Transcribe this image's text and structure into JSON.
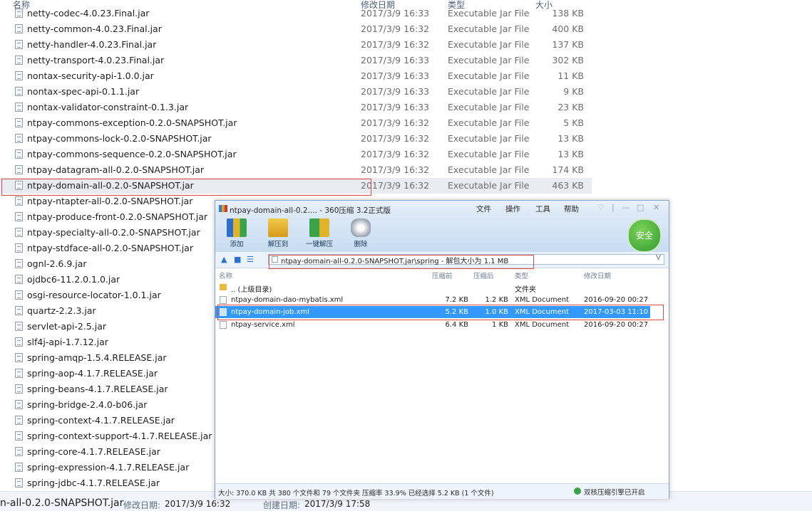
{
  "explorer": {
    "columns": {
      "name": "名称",
      "date": "修改日期",
      "type": "类型",
      "size": "大小"
    },
    "files": [
      {
        "name": "netty-codec-4.0.23.Final.jar",
        "date": "2017/3/9 16:33",
        "type": "Executable Jar File",
        "size": "138 KB"
      },
      {
        "name": "netty-common-4.0.23.Final.jar",
        "date": "2017/3/9 16:32",
        "type": "Executable Jar File",
        "size": "400 KB"
      },
      {
        "name": "netty-handler-4.0.23.Final.jar",
        "date": "2017/3/9 16:32",
        "type": "Executable Jar File",
        "size": "137 KB"
      },
      {
        "name": "netty-transport-4.0.23.Final.jar",
        "date": "2017/3/9 16:33",
        "type": "Executable Jar File",
        "size": "302 KB"
      },
      {
        "name": "nontax-security-api-1.0.0.jar",
        "date": "2017/3/9 16:33",
        "type": "Executable Jar File",
        "size": "11 KB"
      },
      {
        "name": "nontax-spec-api-0.1.1.jar",
        "date": "2017/3/9 16:33",
        "type": "Executable Jar File",
        "size": "9 KB"
      },
      {
        "name": "nontax-validator-constraint-0.1.3.jar",
        "date": "2017/3/9 16:33",
        "type": "Executable Jar File",
        "size": "23 KB"
      },
      {
        "name": "ntpay-commons-exception-0.2.0-SNAPSHOT.jar",
        "date": "2017/3/9 16:32",
        "type": "Executable Jar File",
        "size": "5 KB"
      },
      {
        "name": "ntpay-commons-lock-0.2.0-SNAPSHOT.jar",
        "date": "2017/3/9 16:32",
        "type": "Executable Jar File",
        "size": "13 KB"
      },
      {
        "name": "ntpay-commons-sequence-0.2.0-SNAPSHOT.jar",
        "date": "2017/3/9 16:32",
        "type": "Executable Jar File",
        "size": "13 KB"
      },
      {
        "name": "ntpay-datagram-all-0.2.0-SNAPSHOT.jar",
        "date": "2017/3/9 16:32",
        "type": "Executable Jar File",
        "size": "174 KB"
      },
      {
        "name": "ntpay-domain-all-0.2.0-SNAPSHOT.jar",
        "date": "2017/3/9 16:32",
        "type": "Executable Jar File",
        "size": "463 KB"
      },
      {
        "name": "ntpay-ntapter-all-0.2.0-SNAPSHOT.jar",
        "date": "",
        "type": "",
        "size": ""
      },
      {
        "name": "ntpay-produce-front-0.2.0-SNAPSHOT.jar",
        "date": "",
        "type": "",
        "size": ""
      },
      {
        "name": "ntpay-specialty-all-0.2.0-SNAPSHOT.jar",
        "date": "",
        "type": "",
        "size": ""
      },
      {
        "name": "ntpay-stdface-all-0.2.0-SNAPSHOT.jar",
        "date": "",
        "type": "",
        "size": ""
      },
      {
        "name": "ognl-2.6.9.jar",
        "date": "",
        "type": "",
        "size": ""
      },
      {
        "name": "ojdbc6-11.2.0.1.0.jar",
        "date": "",
        "type": "",
        "size": ""
      },
      {
        "name": "osgi-resource-locator-1.0.1.jar",
        "date": "",
        "type": "",
        "size": ""
      },
      {
        "name": "quartz-2.2.3.jar",
        "date": "",
        "type": "",
        "size": ""
      },
      {
        "name": "servlet-api-2.5.jar",
        "date": "",
        "type": "",
        "size": ""
      },
      {
        "name": "slf4j-api-1.7.12.jar",
        "date": "",
        "type": "",
        "size": ""
      },
      {
        "name": "spring-amqp-1.5.4.RELEASE.jar",
        "date": "",
        "type": "",
        "size": ""
      },
      {
        "name": "spring-aop-4.1.7.RELEASE.jar",
        "date": "",
        "type": "",
        "size": ""
      },
      {
        "name": "spring-beans-4.1.7.RELEASE.jar",
        "date": "",
        "type": "",
        "size": ""
      },
      {
        "name": "spring-bridge-2.4.0-b06.jar",
        "date": "",
        "type": "",
        "size": ""
      },
      {
        "name": "spring-context-4.1.7.RELEASE.jar",
        "date": "",
        "type": "",
        "size": ""
      },
      {
        "name": "spring-context-support-4.1.7.RELEASE.jar",
        "date": "",
        "type": "",
        "size": ""
      },
      {
        "name": "spring-core-4.1.7.RELEASE.jar",
        "date": "",
        "type": "",
        "size": ""
      },
      {
        "name": "spring-expression-4.1.7.RELEASE.jar",
        "date": "",
        "type": "",
        "size": ""
      },
      {
        "name": "spring-jdbc-4.1.7.RELEASE.jar",
        "date": "",
        "type": "",
        "size": ""
      }
    ],
    "selected_index": 11,
    "status": {
      "name": "n-all-0.2.0-SNAPSHOT.jar",
      "modified_label": "修改日期:",
      "modified_value": "2017/3/9 16:32",
      "created_label": "创建日期:",
      "created_value": "2017/3/9 17:58"
    }
  },
  "zip": {
    "title": "ntpay-domain-all-0.2.... - 360压缩 3.2正式版",
    "menus": [
      "文件",
      "操作",
      "工具",
      "帮助"
    ],
    "tools": [
      {
        "label": "添加",
        "icon": "add-archive-icon"
      },
      {
        "label": "解压到",
        "icon": "extract-to-icon"
      },
      {
        "label": "一键解压",
        "icon": "one-click-extract-icon"
      },
      {
        "label": "删除",
        "icon": "delete-icon"
      }
    ],
    "safe_badge": "安全",
    "address": "ntpay-domain-all-0.2.0-SNAPSHOT.jar\\spring - 解包大小为 1.1 MB",
    "address_dropdown": "V",
    "columns": {
      "name": "名称",
      "packed": "压缩前",
      "compressed": "压缩后",
      "type": "类型",
      "modified": "修改日期"
    },
    "rows": [
      {
        "name": ".. (上级目录)",
        "packed": "",
        "compressed": "",
        "type": "文件夹",
        "modified": "",
        "folder": true
      },
      {
        "name": "ntpay-domain-dao-mybatis.xml",
        "packed": "7.2 KB",
        "compressed": "1.2 KB",
        "type": "XML Document",
        "modified": "2016-09-20 00:27"
      },
      {
        "name": "ntpay-domain-job.xml",
        "packed": "5.2 KB",
        "compressed": "1.0 KB",
        "type": "XML Document",
        "modified": "2017-03-03 11:10"
      },
      {
        "name": "ntpay-service.xml",
        "packed": "6.4 KB",
        "compressed": "1 KB",
        "type": "XML Document",
        "modified": "2016-09-20 00:27"
      }
    ],
    "selected_row": 2,
    "status_text": "大小: 370.0 KB 共 380 个文件和 79 个文件夹 压缩率 33.9% 已经选择 5.2 KB (1 个文件)",
    "engine_text": "双核压缩引擎已开启",
    "colors": {
      "selection": "#3399ff",
      "highlight_box": "#e04848",
      "safe_green": "#2f9b2c"
    }
  }
}
